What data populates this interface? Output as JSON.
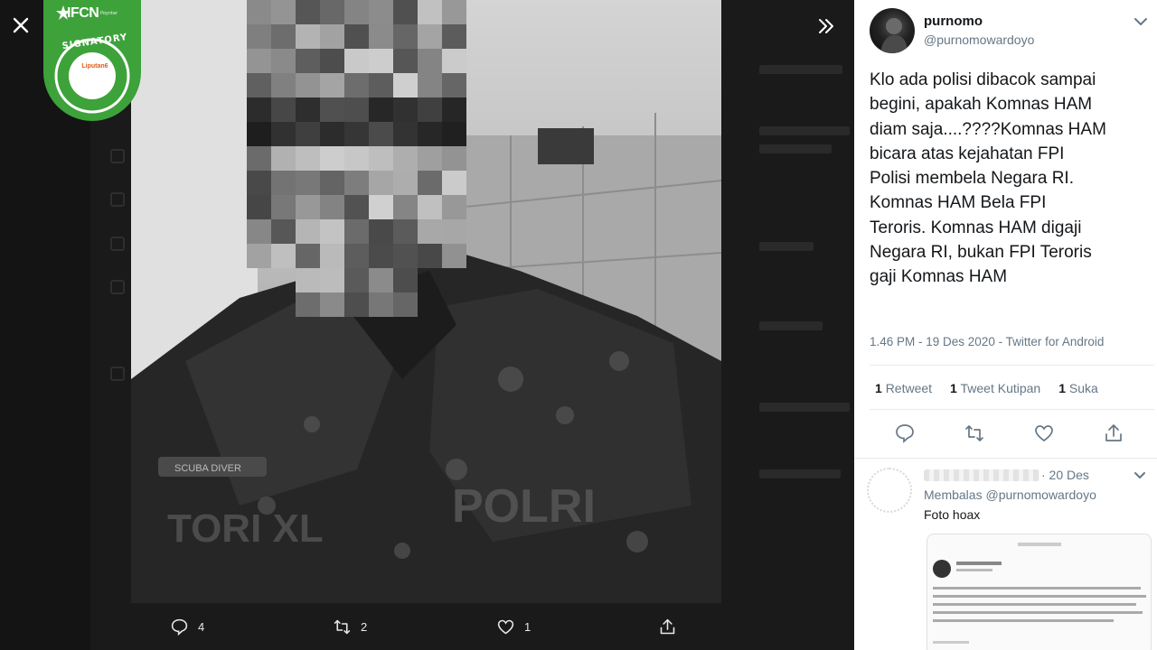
{
  "ifcn_badge": {
    "brand": "IFCN",
    "sub": "Poynter",
    "signatory": "SIGNATORY",
    "member": "Liputan6"
  },
  "media_actions": {
    "reply_count": "4",
    "retweet_count": "2",
    "like_count": "1"
  },
  "tweet": {
    "display_name": "purnomo",
    "handle": "@purnomowardoyo",
    "text": "Klo ada polisi dibacok sampai\nbegini, apakah Komnas HAM\ndiam saja....????Komnas HAM\nbicara atas kejahatan FPI\nPolisi membela Negara RI.\nKomnas HAM Bela FPI\nTeroris. Komnas HAM digaji\nNegara RI, bukan FPI Teroris\ngaji Komnas HAM",
    "meta": "1.46 PM - 19 Des 2020 - Twitter for Android",
    "stats": {
      "retweets_count": "1",
      "retweets_label": "Retweet",
      "quotes_count": "1",
      "quotes_label": "Tweet Kutipan",
      "likes_count": "1",
      "likes_label": "Suka"
    }
  },
  "reply": {
    "time": "· 20 Des",
    "replying_prefix": "Membalas",
    "replying_handle": "@purnomowardoyo",
    "text": "Foto hoax"
  },
  "colors": {
    "ifcn_green": "#3da23a",
    "panel_bg": "#ffffff",
    "viewer_bg": "#141414",
    "secondary_text": "#657786"
  }
}
